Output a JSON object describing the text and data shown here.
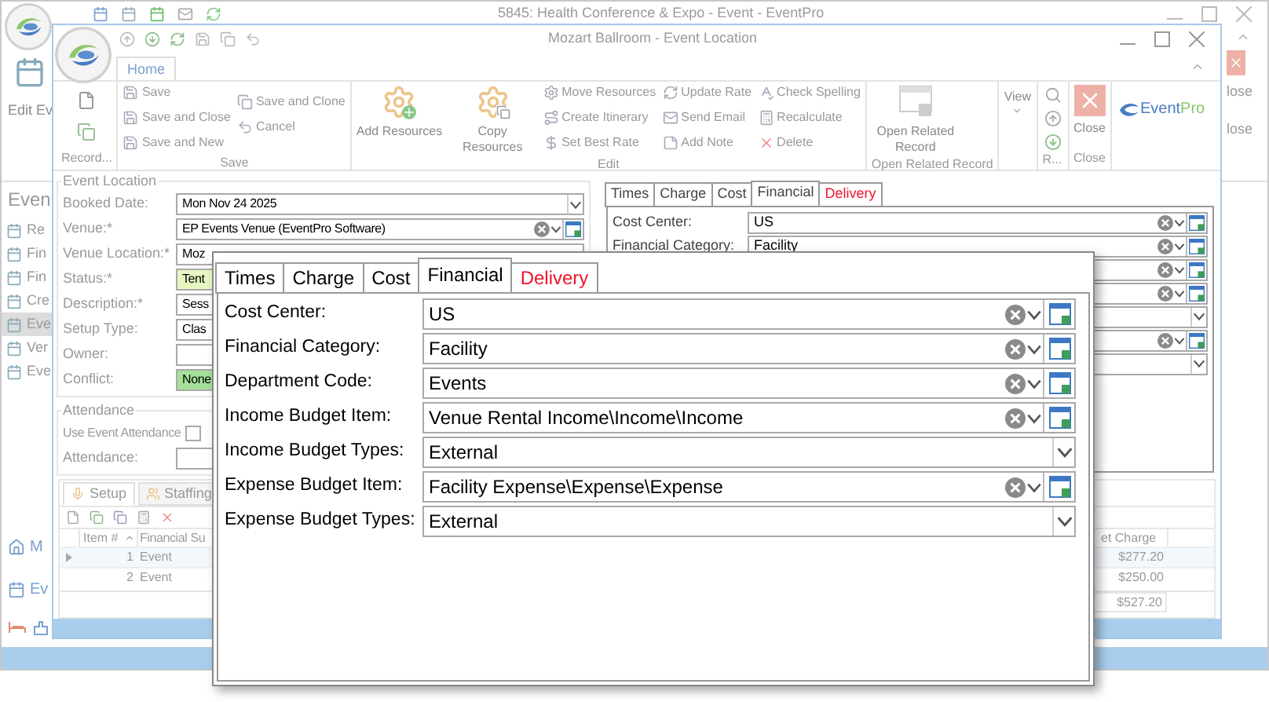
{
  "app_window": {
    "title": "5845: Health Conference & Expo - Event - EventPro",
    "ribbon_button": "Edit Ev",
    "close_labels": [
      "lose",
      "lose"
    ],
    "sidebar_heading": "Even",
    "sidebar_items": [
      {
        "label": "Re",
        "selected": false
      },
      {
        "label": "Fin",
        "selected": false
      },
      {
        "label": "Fin",
        "selected": false
      },
      {
        "label": "Cre",
        "selected": false
      },
      {
        "label": "Eve",
        "selected": true
      },
      {
        "label": "Ver",
        "selected": false
      },
      {
        "label": "Eve",
        "selected": false
      }
    ],
    "nav_items": [
      "M",
      "Ev"
    ]
  },
  "dialog": {
    "title": "Mozart Ballroom - Event Location",
    "ribbon_tab": "Home",
    "ribbon_groups": [
      {
        "kind": "record_icons",
        "label": "Record..."
      },
      {
        "kind": "items",
        "label": "Save",
        "small": [
          "Save",
          "Save and Close",
          "Save and New",
          "Save and Clone",
          "Cancel"
        ]
      },
      {
        "kind": "items",
        "label": "Edit",
        "large": [
          "Add Resources",
          "Copy Resources"
        ],
        "small": [
          "Move Resources",
          "Create Itinerary",
          "Set Best Rate",
          "Update Rate",
          "Send Email",
          "Add Note",
          "Check Spelling",
          "Recalculate",
          "Delete"
        ]
      },
      {
        "kind": "items",
        "label": "Open Related Record",
        "large": [
          "Open Related Record"
        ]
      },
      {
        "kind": "items",
        "large": [
          "View"
        ]
      },
      {
        "kind": "nav_icons",
        "label": "R..."
      },
      {
        "kind": "items",
        "label": "Close",
        "large": [
          "Close"
        ]
      },
      {
        "kind": "logo",
        "parts": [
          "Event",
          "Pro"
        ]
      }
    ],
    "event_location": {
      "heading": "Event Location",
      "fields": [
        {
          "label": "Booked Date:",
          "value": "Mon Nov 24 2025",
          "kind": "dropdown"
        },
        {
          "label": "Venue:*",
          "value": "EP Events Venue (EventPro Software)",
          "kind": "combo"
        },
        {
          "label": "Venue Location:*",
          "value": "Moz",
          "kind": "plain"
        },
        {
          "label": "Status:*",
          "value": "Tent",
          "kind": "plain",
          "color": "#e6f7c2"
        },
        {
          "label": "Description:*",
          "value": "Sess",
          "kind": "plain"
        },
        {
          "label": "Setup Type:",
          "value": "Clas",
          "kind": "plain"
        },
        {
          "label": "Owner:",
          "kind": "plain"
        },
        {
          "label": "Conflict:",
          "value": "None",
          "kind": "plain",
          "color": "#a5e09a"
        }
      ]
    },
    "attendance": {
      "heading": "Attendance",
      "use_event_attendance": {
        "label": "Use Event Attendance",
        "checked": false
      },
      "attendance_label": "Attendance:"
    },
    "financial_panel": {
      "tabs": [
        {
          "label": "Times",
          "selected": false,
          "alert": false
        },
        {
          "label": "Charge",
          "selected": false,
          "alert": false
        },
        {
          "label": "Cost",
          "selected": false,
          "alert": false
        },
        {
          "label": "Financial",
          "selected": true,
          "alert": false
        },
        {
          "label": "Delivery",
          "selected": false,
          "alert": true
        }
      ],
      "fields": [
        {
          "label": "Cost Center:",
          "value": "US",
          "kind": "combo"
        },
        {
          "label": "Financial Category:",
          "value": "Facility",
          "kind": "combo"
        },
        {
          "kind": "combo"
        },
        {
          "kind": "combo"
        },
        {
          "kind": "dropdown"
        },
        {
          "kind": "combo"
        },
        {
          "kind": "dropdown"
        }
      ]
    },
    "grid": {
      "tabs": [
        {
          "label": "Setup",
          "selected": true
        },
        {
          "label": "Staffing",
          "selected": false
        }
      ],
      "columns": [
        "Item #",
        "Financial Su",
        "et Charge"
      ],
      "rows": [
        {
          "item": "1",
          "category": "Event",
          "net_charge": "$277.20"
        },
        {
          "item": "2",
          "category": "Event",
          "net_charge": "$250.00"
        }
      ],
      "total": "$527.20"
    }
  },
  "popup": {
    "tabs": [
      {
        "label": "Times",
        "selected": false,
        "alert": false
      },
      {
        "label": "Charge",
        "selected": false,
        "alert": false
      },
      {
        "label": "Cost",
        "selected": false,
        "alert": false
      },
      {
        "label": "Financial",
        "selected": true,
        "alert": false
      },
      {
        "label": "Delivery",
        "selected": false,
        "alert": true
      }
    ],
    "fields": [
      {
        "label": "Cost Center:",
        "value": "US",
        "kind": "combo"
      },
      {
        "label": "Financial Category:",
        "value": "Facility",
        "kind": "combo"
      },
      {
        "label": "Department Code:",
        "value": "Events",
        "kind": "combo"
      },
      {
        "label": "Income Budget Item:",
        "value": "Venue Rental Income\\Income\\Income",
        "kind": "combo"
      },
      {
        "label": "Income Budget Types:",
        "value": "External",
        "kind": "dropdown"
      },
      {
        "label": "Expense Budget Item:",
        "value": "Facility Expense\\Expense\\Expense",
        "kind": "combo"
      },
      {
        "label": "Expense Budget Types:",
        "value": "External",
        "kind": "dropdown"
      }
    ]
  }
}
